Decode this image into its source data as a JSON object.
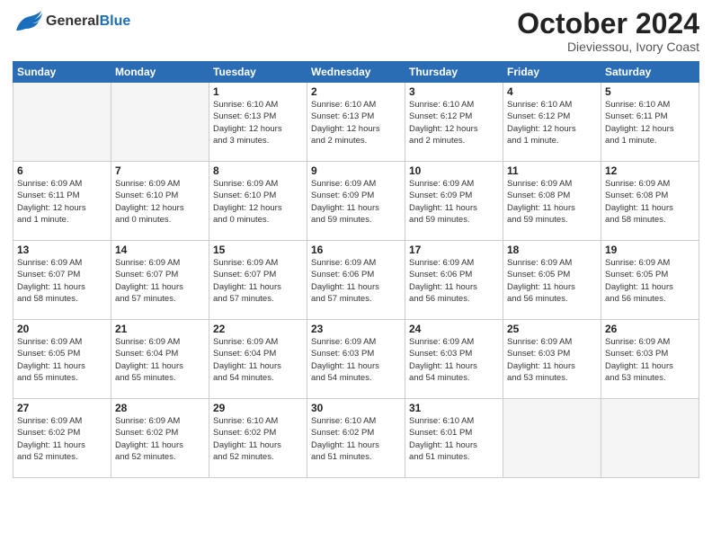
{
  "header": {
    "logo": {
      "general": "General",
      "blue": "Blue"
    },
    "title": "October 2024",
    "location": "Dieviessou, Ivory Coast"
  },
  "calendar": {
    "days": [
      "Sunday",
      "Monday",
      "Tuesday",
      "Wednesday",
      "Thursday",
      "Friday",
      "Saturday"
    ],
    "weeks": [
      [
        {
          "day": "",
          "info": ""
        },
        {
          "day": "",
          "info": ""
        },
        {
          "day": "1",
          "info": "Sunrise: 6:10 AM\nSunset: 6:13 PM\nDaylight: 12 hours\nand 3 minutes."
        },
        {
          "day": "2",
          "info": "Sunrise: 6:10 AM\nSunset: 6:13 PM\nDaylight: 12 hours\nand 2 minutes."
        },
        {
          "day": "3",
          "info": "Sunrise: 6:10 AM\nSunset: 6:12 PM\nDaylight: 12 hours\nand 2 minutes."
        },
        {
          "day": "4",
          "info": "Sunrise: 6:10 AM\nSunset: 6:12 PM\nDaylight: 12 hours\nand 1 minute."
        },
        {
          "day": "5",
          "info": "Sunrise: 6:10 AM\nSunset: 6:11 PM\nDaylight: 12 hours\nand 1 minute."
        }
      ],
      [
        {
          "day": "6",
          "info": "Sunrise: 6:09 AM\nSunset: 6:11 PM\nDaylight: 12 hours\nand 1 minute."
        },
        {
          "day": "7",
          "info": "Sunrise: 6:09 AM\nSunset: 6:10 PM\nDaylight: 12 hours\nand 0 minutes."
        },
        {
          "day": "8",
          "info": "Sunrise: 6:09 AM\nSunset: 6:10 PM\nDaylight: 12 hours\nand 0 minutes."
        },
        {
          "day": "9",
          "info": "Sunrise: 6:09 AM\nSunset: 6:09 PM\nDaylight: 11 hours\nand 59 minutes."
        },
        {
          "day": "10",
          "info": "Sunrise: 6:09 AM\nSunset: 6:09 PM\nDaylight: 11 hours\nand 59 minutes."
        },
        {
          "day": "11",
          "info": "Sunrise: 6:09 AM\nSunset: 6:08 PM\nDaylight: 11 hours\nand 59 minutes."
        },
        {
          "day": "12",
          "info": "Sunrise: 6:09 AM\nSunset: 6:08 PM\nDaylight: 11 hours\nand 58 minutes."
        }
      ],
      [
        {
          "day": "13",
          "info": "Sunrise: 6:09 AM\nSunset: 6:07 PM\nDaylight: 11 hours\nand 58 minutes."
        },
        {
          "day": "14",
          "info": "Sunrise: 6:09 AM\nSunset: 6:07 PM\nDaylight: 11 hours\nand 57 minutes."
        },
        {
          "day": "15",
          "info": "Sunrise: 6:09 AM\nSunset: 6:07 PM\nDaylight: 11 hours\nand 57 minutes."
        },
        {
          "day": "16",
          "info": "Sunrise: 6:09 AM\nSunset: 6:06 PM\nDaylight: 11 hours\nand 57 minutes."
        },
        {
          "day": "17",
          "info": "Sunrise: 6:09 AM\nSunset: 6:06 PM\nDaylight: 11 hours\nand 56 minutes."
        },
        {
          "day": "18",
          "info": "Sunrise: 6:09 AM\nSunset: 6:05 PM\nDaylight: 11 hours\nand 56 minutes."
        },
        {
          "day": "19",
          "info": "Sunrise: 6:09 AM\nSunset: 6:05 PM\nDaylight: 11 hours\nand 56 minutes."
        }
      ],
      [
        {
          "day": "20",
          "info": "Sunrise: 6:09 AM\nSunset: 6:05 PM\nDaylight: 11 hours\nand 55 minutes."
        },
        {
          "day": "21",
          "info": "Sunrise: 6:09 AM\nSunset: 6:04 PM\nDaylight: 11 hours\nand 55 minutes."
        },
        {
          "day": "22",
          "info": "Sunrise: 6:09 AM\nSunset: 6:04 PM\nDaylight: 11 hours\nand 54 minutes."
        },
        {
          "day": "23",
          "info": "Sunrise: 6:09 AM\nSunset: 6:03 PM\nDaylight: 11 hours\nand 54 minutes."
        },
        {
          "day": "24",
          "info": "Sunrise: 6:09 AM\nSunset: 6:03 PM\nDaylight: 11 hours\nand 54 minutes."
        },
        {
          "day": "25",
          "info": "Sunrise: 6:09 AM\nSunset: 6:03 PM\nDaylight: 11 hours\nand 53 minutes."
        },
        {
          "day": "26",
          "info": "Sunrise: 6:09 AM\nSunset: 6:03 PM\nDaylight: 11 hours\nand 53 minutes."
        }
      ],
      [
        {
          "day": "27",
          "info": "Sunrise: 6:09 AM\nSunset: 6:02 PM\nDaylight: 11 hours\nand 52 minutes."
        },
        {
          "day": "28",
          "info": "Sunrise: 6:09 AM\nSunset: 6:02 PM\nDaylight: 11 hours\nand 52 minutes."
        },
        {
          "day": "29",
          "info": "Sunrise: 6:10 AM\nSunset: 6:02 PM\nDaylight: 11 hours\nand 52 minutes."
        },
        {
          "day": "30",
          "info": "Sunrise: 6:10 AM\nSunset: 6:02 PM\nDaylight: 11 hours\nand 51 minutes."
        },
        {
          "day": "31",
          "info": "Sunrise: 6:10 AM\nSunset: 6:01 PM\nDaylight: 11 hours\nand 51 minutes."
        },
        {
          "day": "",
          "info": ""
        },
        {
          "day": "",
          "info": ""
        }
      ]
    ]
  }
}
